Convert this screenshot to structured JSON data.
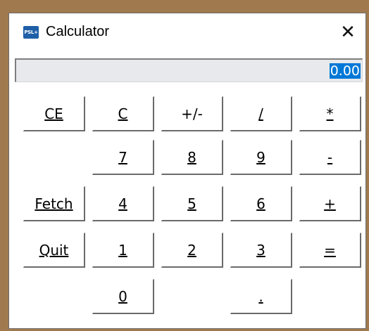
{
  "window": {
    "title": "Calculator",
    "icon_name": "psl-app-icon",
    "icon_text": "PSL+",
    "close_glyph": "✕"
  },
  "display": {
    "value": "0.00",
    "highlight_color": "#0078d7"
  },
  "keys": {
    "ce": "CE",
    "clear": "C",
    "negate": "+/-",
    "divide": "/",
    "multiply": "*",
    "seven": "7",
    "eight": "8",
    "nine": "9",
    "subtract": "-",
    "fetch": "Fetch",
    "four": "4",
    "five": "5",
    "six": "6",
    "add": "+",
    "quit": "Quit",
    "one": "1",
    "two": "2",
    "three": "3",
    "equals": "=",
    "zero": "0",
    "decimal": "."
  }
}
